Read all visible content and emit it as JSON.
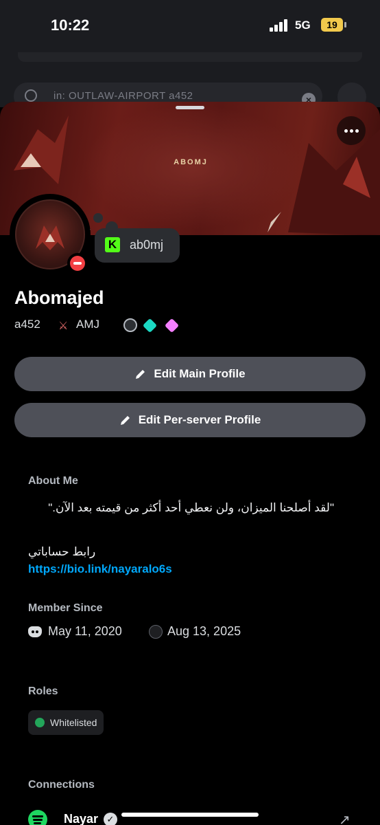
{
  "status_bar": {
    "time": "10:22",
    "network": "5G",
    "battery": "19"
  },
  "search": {
    "text": "in:  OUTLAW-AIRPORT    a452"
  },
  "banner": {
    "logo_text": "ABOMJ"
  },
  "custom_status": {
    "platform_icon": "kick-icon",
    "text": "ab0mj"
  },
  "profile": {
    "display_name": "Abomajed",
    "username": "a452",
    "server_tag": "AMJ",
    "badges": [
      "nitro-icon",
      "boost-icon",
      "gem-icon"
    ]
  },
  "buttons": {
    "edit_main": "Edit Main Profile",
    "edit_server": "Edit Per-server Profile"
  },
  "about": {
    "label": "About Me",
    "quote": "\"لقد أصلحنا الميزان، ولن نعطي أحد أكثر من قيمته بعد الآن.\"",
    "sub": "رابط حساباتي",
    "link": "https://bio.link/nayaralo6s"
  },
  "member_since": {
    "label": "Member Since",
    "discord_date": "May 11, 2020",
    "server_date": "Aug 13, 2025"
  },
  "roles": {
    "label": "Roles",
    "items": [
      "Whitelisted"
    ],
    "color": "#23a55a"
  },
  "connections": {
    "label": "Connections",
    "items": [
      {
        "service": "spotify-icon",
        "name": "Nayar"
      }
    ]
  }
}
